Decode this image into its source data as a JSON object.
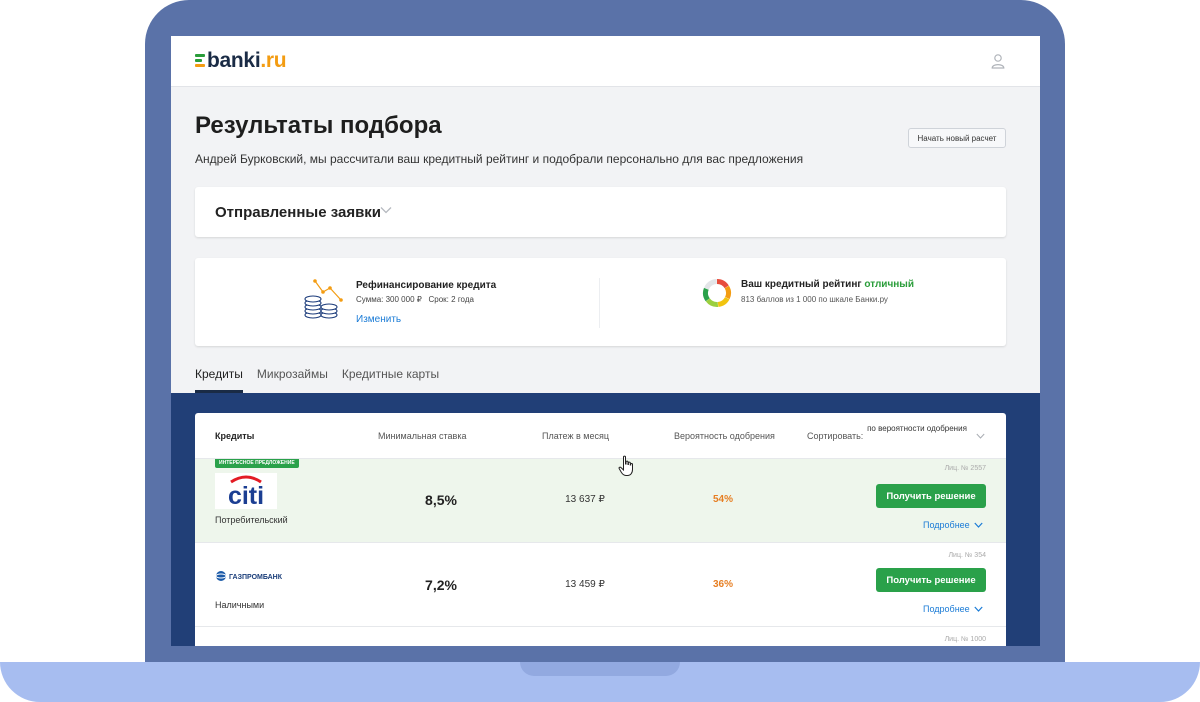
{
  "brand": {
    "logo_text": "banki",
    "logo_tld": ".ru",
    "accent_green": "#2aa14a",
    "accent_orange": "#f39c12",
    "navy": "#213f77"
  },
  "header": {
    "user_icon": "user-icon"
  },
  "page": {
    "title": "Результаты подбора",
    "new_calc_label": "Начать новый расчет",
    "subtitle": "Андрей Бурковский, мы рассчитали ваш кредитный рейтинг и подобрали персонально для вас предложения"
  },
  "applications": {
    "title": "Отправленные заявки"
  },
  "summary": {
    "refi_title": "Рефинансирование кредита",
    "sum_label": "Сумма:",
    "sum_value": "300 000 ₽",
    "term_label": "Срок:",
    "term_value": "2 года",
    "change_label": "Изменить",
    "rating_title": "Ваш кредитный рейтинг",
    "rating_status": "отличный",
    "rating_detail": "813 баллов из 1 000 по шкале Банки.ру",
    "rating_score": 813,
    "rating_max": 1000
  },
  "tabs": [
    {
      "label": "Кредиты",
      "active": true
    },
    {
      "label": "Микрозаймы",
      "active": false
    },
    {
      "label": "Кредитные карты",
      "active": false
    }
  ],
  "table": {
    "headers": {
      "product": "Кредиты",
      "rate": "Минимальная ставка",
      "payment": "Платеж в месяц",
      "probability": "Вероятность одобрения",
      "sort_label": "Сортировать:",
      "sort_value": "по вероятности одобрения"
    },
    "offers": [
      {
        "badge": "ИНТЕРЕСНОЕ ПРЕДЛОЖЕНИЕ",
        "bank_logo_text": "citi",
        "product": "Потребительский",
        "rate": "8,5%",
        "payment": "13 637 ₽",
        "probability": "54%",
        "license": "Лиц. № 2557",
        "button": "Получить решение",
        "more": "Подробнее"
      },
      {
        "badge": "",
        "bank_logo_text": "ГАЗПРОМБАНК",
        "product": "Наличными",
        "rate": "7,2%",
        "payment": "13 459 ₽",
        "probability": "36%",
        "license": "Лиц. № 354",
        "button": "Получить решение",
        "more": "Подробнее"
      },
      {
        "license": "Лиц. № 1000"
      }
    ]
  }
}
